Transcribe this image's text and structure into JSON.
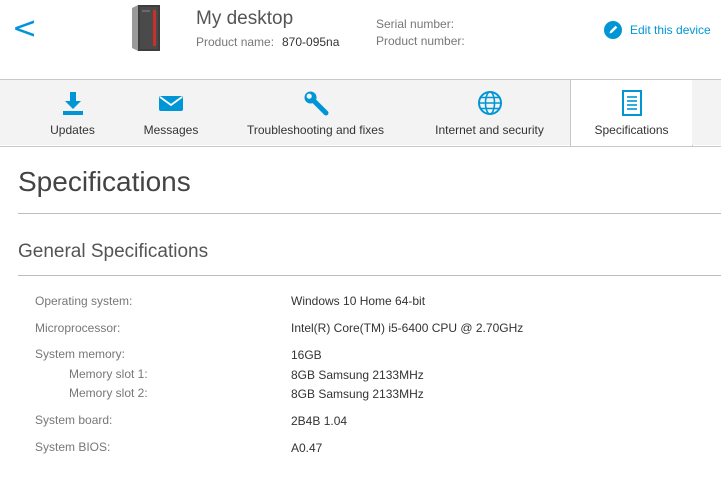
{
  "header": {
    "back_glyph": "<",
    "device_name": "My desktop",
    "product_name_label": "Product name:",
    "product_name_value": "870-095na",
    "serial_number_label": "Serial number:",
    "product_number_label": "Product number:",
    "edit_label": "Edit this device"
  },
  "tabs": [
    {
      "label": "Updates",
      "icon": "download-icon"
    },
    {
      "label": "Messages",
      "icon": "envelope-icon"
    },
    {
      "label": "Troubleshooting and fixes",
      "icon": "wrench-icon"
    },
    {
      "label": "Internet and security",
      "icon": "globe-icon"
    },
    {
      "label": "Specifications",
      "icon": "document-icon",
      "active": true
    }
  ],
  "main": {
    "page_title": "Specifications",
    "section_title": "General Specifications",
    "specs": {
      "os_label": "Operating system:",
      "os_value": "Windows 10 Home 64-bit",
      "cpu_label": "Microprocessor:",
      "cpu_value": "Intel(R) Core(TM) i5-6400 CPU @ 2.70GHz",
      "memory_label": "System memory:",
      "memory_value": "16GB",
      "slot1_label": "Memory slot 1:",
      "slot1_value": "8GB  Samsung 2133MHz",
      "slot2_label": "Memory slot 2:",
      "slot2_value": "8GB  Samsung 2133MHz",
      "board_label": "System board:",
      "board_value": "2B4B 1.04",
      "bios_label": "System BIOS:",
      "bios_value": "A0.47"
    }
  },
  "colors": {
    "accent": "#0096d6",
    "tab_background": "#f3f3f3",
    "border": "#c8c8c8"
  }
}
